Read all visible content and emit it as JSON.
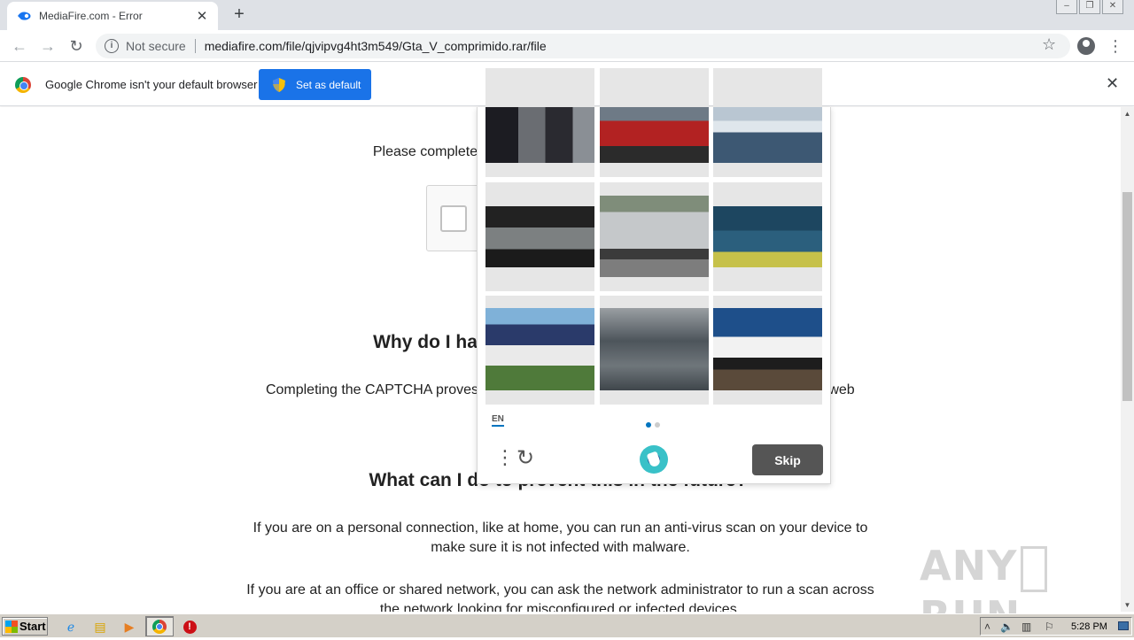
{
  "browser": {
    "tab_title": "MediaFire.com - Error",
    "tab_close": "✕",
    "new_tab": "+",
    "security_label": "Not secure",
    "url": "mediafire.com/file/qjvipvg4ht3m549/Gta_V_comprimido.rar/file"
  },
  "infobar": {
    "message": "Google Chrome isn't your default browser",
    "button_label": "Set as default",
    "close": "✕"
  },
  "page": {
    "line1": "Please complete",
    "heading1": "Why do I ha",
    "line2_left": "Completing the CAPTCHA proves",
    "line2_right": "web",
    "heading2": "What can I do to prevent this in the future?",
    "para1_a": "If you are on a personal connection, like at home, you can run an anti-virus scan on your device to",
    "para1_b": "make sure it is not infected with malware.",
    "para2_a": "If you are at an office or shared network, you can ask the network administrator to run a scan across",
    "para2_b": "the network looking for misconfigured or infected devices."
  },
  "captcha": {
    "language": "EN",
    "skip_label": "Skip",
    "page_count": 2,
    "current_page": 1,
    "tiles": [
      {
        "name": "tile-people"
      },
      {
        "name": "tile-fire-truck"
      },
      {
        "name": "tile-boat-dock"
      },
      {
        "name": "tile-car"
      },
      {
        "name": "tile-truck-tanker"
      },
      {
        "name": "tile-kayak"
      },
      {
        "name": "tile-garbage-truck"
      },
      {
        "name": "tile-water"
      },
      {
        "name": "tile-speedboat"
      }
    ]
  },
  "watermark": {
    "left": "ANY",
    "right": "RUN"
  },
  "taskbar": {
    "start_label": "Start",
    "clock": "5:28 PM"
  }
}
